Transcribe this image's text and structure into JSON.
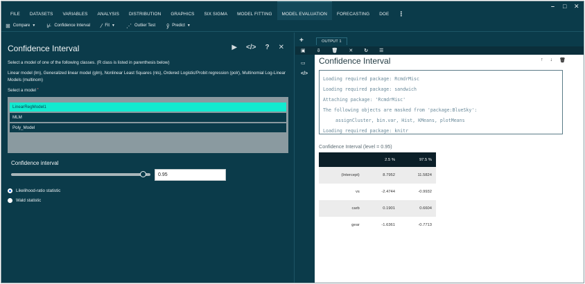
{
  "menu": {
    "items": [
      "FILE",
      "DATASETS",
      "VARIABLES",
      "ANALYSIS",
      "DISTRIBUTION",
      "GRAPHICS",
      "SIX SIGMA",
      "MODEL FITTING",
      "MODEL EVALUATION",
      "FORECASTING",
      "DOE"
    ],
    "active": "MODEL EVALUATION",
    "more": "⋮"
  },
  "window": {
    "minimize": "–",
    "maximize": "□",
    "close": "✕"
  },
  "toolbar": {
    "compare": "Compare",
    "confidence_interval": "Confidence Interval",
    "fit": "Fit",
    "outlier_test": "Outlier Test",
    "predict": "Predict"
  },
  "dialog": {
    "title": "Confidence Interval",
    "intro": "Select a model of one of the following classes. (R class is listed in parenthesis below)",
    "classes": "Linear model (lm), Generalized linear model (glm), Nonlinear Least Squares (nls), Ordered Logistic/Probit regression (polr), Multinomial Log-Linear Models (multinom)",
    "select_label": "Select a model",
    "required_mark": "*",
    "models": [
      "LinearRegModel1",
      "MLM",
      "Poly_Model"
    ],
    "selected_model": "LinearRegModel1",
    "ci_label": "Confidence interval",
    "ci_value": "0.95",
    "ci_fraction": 0.95,
    "radio_likelihood": "Likelihood-ratio statistic",
    "radio_wald": "Wald statistic",
    "radio_selected": "likelihood"
  },
  "output": {
    "tab": "OUTPUT 1",
    "title": "Confidence Interval",
    "console": [
      "Loading required package: RcmdrMisc",
      "Loading required package: sandwich",
      "Attaching package: 'RcmdrMisc'",
      "The following objects are masked from 'package:BlueSky':",
      "assignCluster, bin.var, Hist, KMeans, plotMeans",
      "Loading required package: knitr"
    ],
    "table_caption": "Confidence Interval (level = 0.95)",
    "table_headers": [
      "",
      "2.5 %",
      "97.5 %"
    ],
    "table_rows": [
      [
        "(Intercept)",
        "8.7952",
        "11.5824"
      ],
      [
        "vs",
        "-2.4744",
        "-0.9932"
      ],
      [
        "carb",
        "0.1901",
        "0.6604"
      ],
      [
        "gear",
        "-1.6361",
        "-0.7713"
      ]
    ]
  },
  "colors": {
    "app_bg": "#0b3b4a",
    "selected_item": "#12ead0",
    "table_header": "#0b1f28"
  }
}
